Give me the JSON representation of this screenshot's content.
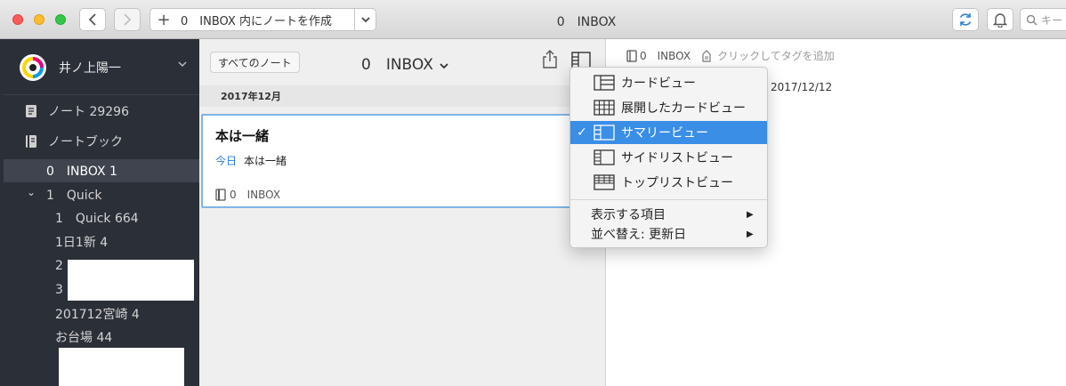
{
  "titlebar": {
    "new_note_plus": "+",
    "new_note_label": "0　INBOX 内にノートを作成",
    "window_title": "0　INBOX",
    "search_placeholder": "キー",
    "icons": [
      "back-arrow-icon",
      "forward-arrow-icon",
      "sync-icon",
      "bell-icon",
      "search-icon"
    ]
  },
  "sidebar": {
    "account_name": "井ノ上陽一",
    "items": [
      {
        "label": "ノート 29296",
        "icon": "note-icon"
      },
      {
        "label": "ノートブック",
        "icon": "notebook-icon"
      },
      {
        "label": "0　INBOX 1"
      },
      {
        "label": "1　Quick"
      },
      {
        "label": "1　Quick 664"
      },
      {
        "label": "1日1新 4"
      },
      {
        "label": "2"
      },
      {
        "label": "3"
      },
      {
        "label": "201712宮崎 4"
      },
      {
        "label": "お台場 44"
      }
    ],
    "expand_glyph": "⌄"
  },
  "notelist": {
    "all_notes_button": "すべてのノート",
    "notebook_title": "0　INBOX",
    "title_caret": "⌄",
    "date_header": "2017年12月",
    "note": {
      "title": "本は一緒",
      "date": "今日",
      "snippet": "本は一緒",
      "notebook": "0　INBOX"
    }
  },
  "detail": {
    "notebook": "0　INBOX",
    "tag_placeholder": "クリックしてタグを追加",
    "date": "2017/12/12"
  },
  "menu": {
    "items": [
      {
        "label": "カードビュー",
        "icon": "card-view-icon",
        "checked": false
      },
      {
        "label": "展開したカードビュー",
        "icon": "expanded-card-view-icon",
        "checked": false
      },
      {
        "label": "サマリービュー",
        "icon": "summary-view-icon",
        "checked": true
      },
      {
        "label": "サイドリストビュー",
        "icon": "side-list-view-icon",
        "checked": false
      },
      {
        "label": "トップリストビュー",
        "icon": "top-list-view-icon",
        "checked": false
      }
    ],
    "check_glyph": "✓",
    "submenus": [
      {
        "label": "表示する項目"
      },
      {
        "label": "並べ替え: 更新日"
      }
    ],
    "submenu_arrow": "▶"
  },
  "colors": {
    "sidebar_bg": "#2b2f38",
    "selection_blue": "#3a8ee6",
    "card_border": "#7fb5e6",
    "today_blue": "#2b7bd6"
  }
}
